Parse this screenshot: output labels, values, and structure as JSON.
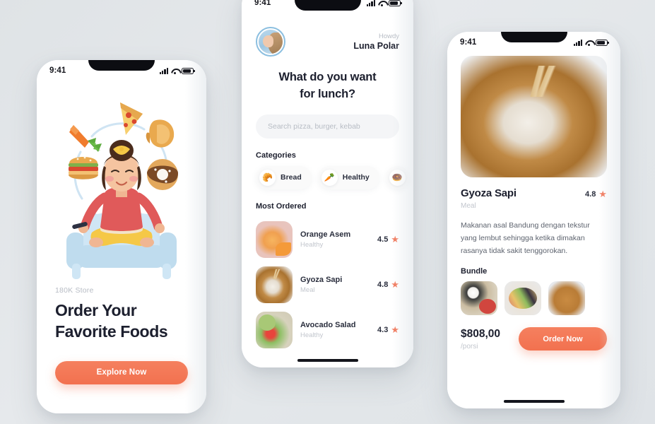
{
  "theme": {
    "accent": "#f2795c",
    "dark": "#1c1f2e",
    "muted": "#c2c6cd",
    "bg": "#e2e6e9"
  },
  "status_bar": {
    "time": "9:41",
    "icons": [
      "signal-icon",
      "wifi-icon",
      "battery-icon"
    ]
  },
  "screen_onboarding": {
    "store_label": "180K Store",
    "headline_line1": "Order Your",
    "headline_line2": "Favorite Foods",
    "cta_label": "Explore Now",
    "illustration": {
      "name": "woman-meditating-illustration",
      "orbit_items": [
        "pizza-icon",
        "croissant-icon",
        "donut-icon",
        "burger-icon",
        "carrot-icon"
      ]
    }
  },
  "screen_home": {
    "greeting_small": "Howdy",
    "user_name": "Luna Polar",
    "avatar": "user-avatar",
    "question_line1": "What do you want",
    "question_line2": "for lunch?",
    "search_placeholder": "Search pizza, burger, kebab",
    "categories_title": "Categories",
    "categories": [
      {
        "label": "Bread",
        "icon": "croissant-icon"
      },
      {
        "label": "Healthy",
        "icon": "carrot-icon"
      },
      {
        "label": "",
        "icon": "donut-icon"
      }
    ],
    "most_ordered_title": "Most Ordered",
    "most_ordered": [
      {
        "name": "Orange Asem",
        "category": "Healthy",
        "rating": "4.5",
        "thumb": "orange-drink-photo"
      },
      {
        "name": "Gyoza Sapi",
        "category": "Meal",
        "rating": "4.8",
        "thumb": "gyoza-photo"
      },
      {
        "name": "Avocado Salad",
        "category": "Healthy",
        "rating": "4.3",
        "thumb": "avocado-salad-photo"
      }
    ]
  },
  "screen_detail": {
    "hero_photo": "gyoza-bowl-photo",
    "title": "Gyoza Sapi",
    "category": "Meal",
    "rating": "4.8",
    "description": "Makanan asal Bandung dengan tekstur yang lembut sehingga ketika dimakan rasanya tidak sakit tenggorokan.",
    "bundle_title": "Bundle",
    "bundle": [
      {
        "thumb": "granola-bowl-photo"
      },
      {
        "thumb": "charcuterie-plate-photo"
      },
      {
        "thumb": "egg-toast-photo"
      }
    ],
    "price": "$808,00",
    "price_unit": "/porsi",
    "order_label": "Order Now"
  }
}
